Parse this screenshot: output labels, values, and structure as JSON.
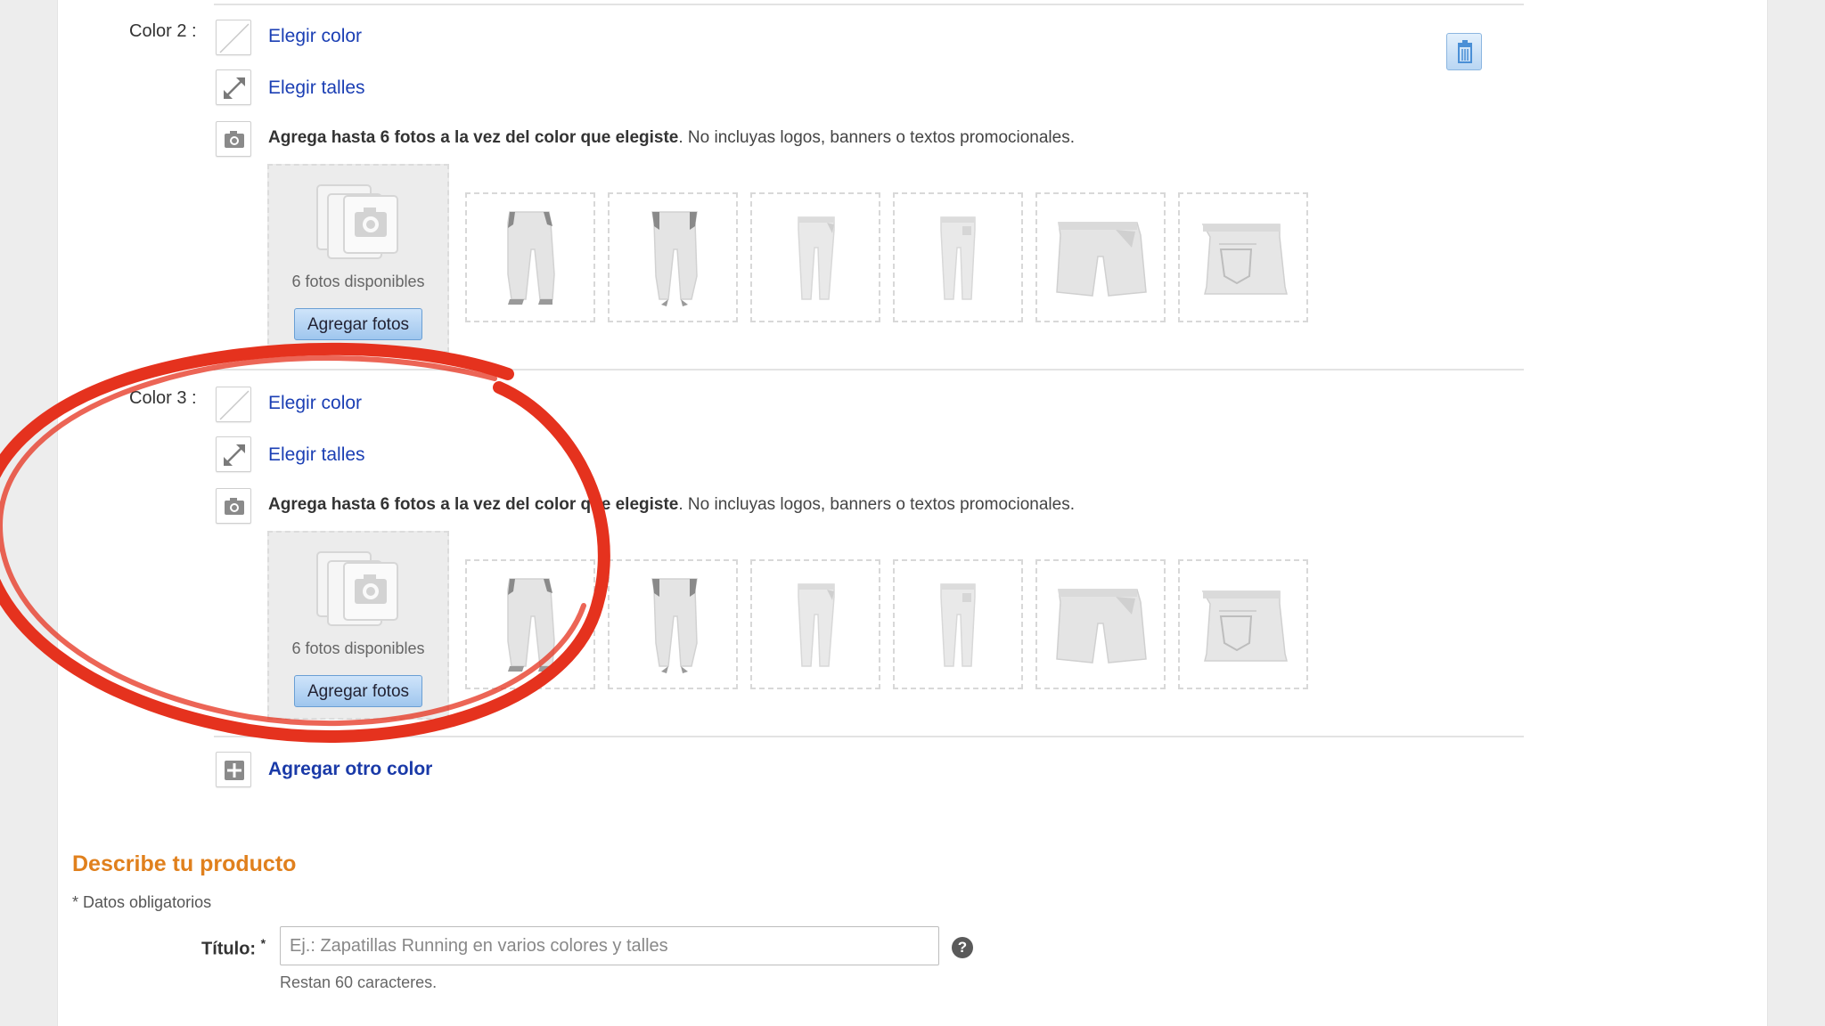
{
  "colors": [
    {
      "label": "Color 2 :",
      "choose_color": "Elegir color",
      "choose_sizes": "Elegir talles",
      "instruction_bold": "Agrega hasta 6 fotos a la vez del color que elegiste",
      "instruction_rest": ". No incluyas logos, banners o textos promocionales.",
      "photos_available": "6 fotos disponibles",
      "add_photos": "Agregar fotos"
    },
    {
      "label": "Color 3 :",
      "choose_color": "Elegir color",
      "choose_sizes": "Elegir talles",
      "instruction_bold": "Agrega hasta 6 fotos a la vez del color que elegiste",
      "instruction_rest": ". No incluyas logos, banners o textos promocionales.",
      "photos_available": "6 fotos disponibles",
      "add_photos": "Agregar fotos"
    }
  ],
  "add_other_color": "Agregar otro color",
  "describe": {
    "title": "Describe tu producto",
    "required_note": "* Datos obligatorios",
    "title_label": "Título:",
    "required_mark": "*",
    "title_placeholder": "Ej.: Zapatillas Running en varios colores y talles",
    "title_value": "",
    "remaining": "Restan 60 caracteres.",
    "help_symbol": "?"
  },
  "photo_guides": [
    "pants-front-icon",
    "pants-back-icon",
    "pants-side-icon",
    "pants-side-back-icon",
    "shorts-front-icon",
    "shorts-back-icon"
  ],
  "accent": {
    "link": "#1b3fb4",
    "section_title": "#e0801d",
    "highlight_circle": "#e5321e"
  }
}
